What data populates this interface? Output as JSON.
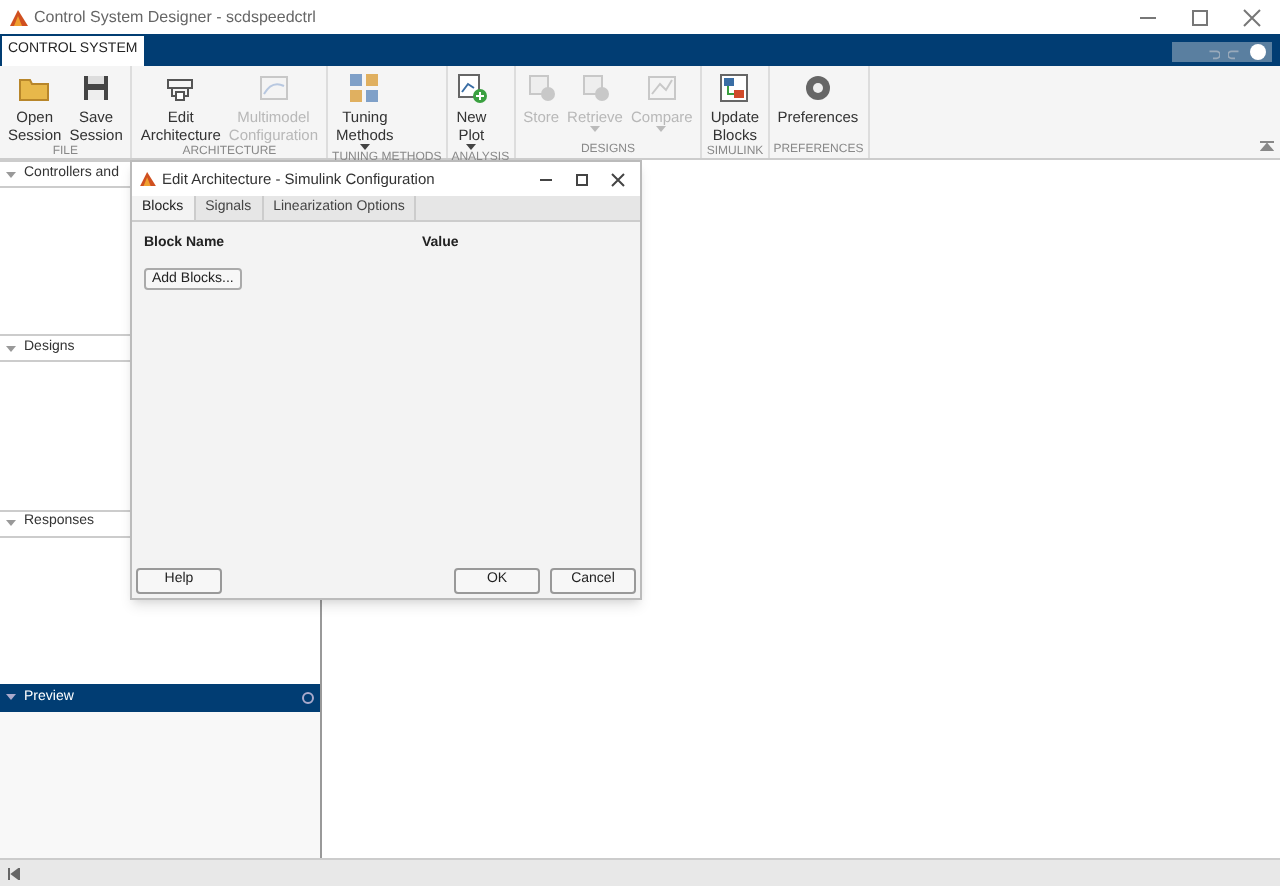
{
  "window": {
    "title": "Control System Designer - scdspeedctrl"
  },
  "ribbon_tabs": [
    {
      "label": "CONTROL SYSTEM",
      "selected": true
    }
  ],
  "toolbar_groups": [
    {
      "label": "FILE",
      "buttons": [
        {
          "kind": "folder",
          "label": "Open\nSession",
          "disabled": false,
          "dropdown": false
        },
        {
          "kind": "save",
          "label": "Save\nSession",
          "disabled": false,
          "dropdown": false
        }
      ]
    },
    {
      "label": "ARCHITECTURE",
      "buttons": [
        {
          "kind": "architecture",
          "label": "Edit\nArchitecture",
          "disabled": false,
          "dropdown": false
        },
        {
          "kind": "multimodel",
          "label": "Multimodel\nConfiguration",
          "disabled": true,
          "dropdown": false
        }
      ]
    },
    {
      "label": "TUNING METHODS",
      "buttons": [
        {
          "kind": "tuning",
          "label": "Tuning\nMethods",
          "disabled": false,
          "dropdown": true
        }
      ]
    },
    {
      "label": "ANALYSIS",
      "buttons": [
        {
          "kind": "plot",
          "label": "New\nPlot",
          "disabled": false,
          "dropdown": true
        }
      ]
    },
    {
      "label": "DESIGNS",
      "buttons": [
        {
          "kind": "store",
          "label": "Store",
          "disabled": true,
          "dropdown": false
        },
        {
          "kind": "retrieve",
          "label": "Retrieve",
          "disabled": true,
          "dropdown": true
        },
        {
          "kind": "compare",
          "label": "Compare",
          "disabled": true,
          "dropdown": true
        }
      ]
    },
    {
      "label": "SIMULINK",
      "buttons": [
        {
          "kind": "update",
          "label": "Update\nBlocks",
          "disabled": false,
          "dropdown": false
        }
      ]
    },
    {
      "label": "PREFERENCES",
      "buttons": [
        {
          "kind": "gear",
          "label": "Preferences",
          "disabled": false,
          "dropdown": false
        }
      ]
    }
  ],
  "panels": [
    {
      "title": "Controllers and",
      "selected": false
    },
    {
      "title": "Designs",
      "selected": false
    },
    {
      "title": "Responses",
      "selected": false
    },
    {
      "title": "Preview",
      "selected": true
    }
  ],
  "dialog": {
    "title": "Edit Architecture - Simulink Configuration",
    "tabs": [
      {
        "label": "Blocks",
        "selected": true
      },
      {
        "label": "Signals",
        "selected": false
      },
      {
        "label": "Linearization Options",
        "selected": false
      }
    ],
    "columns": [
      "Block Name",
      "Value"
    ],
    "add_button": "Add Blocks...",
    "help_button": "Help",
    "ok_button": "OK",
    "cancel_button": "Cancel"
  }
}
